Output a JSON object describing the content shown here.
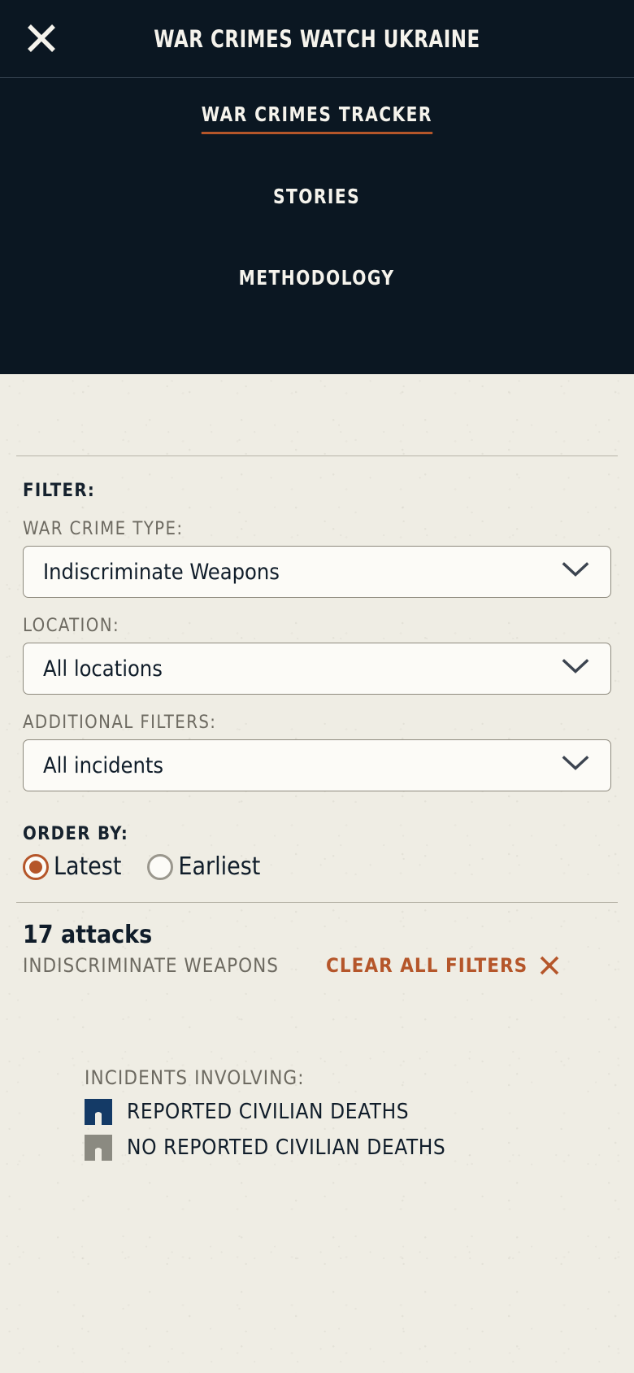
{
  "header": {
    "close_icon": "close-icon",
    "title": "WAR CRIMES WATCH UKRAINE",
    "background_color": "#0b1722",
    "accent_color": "#b5562a",
    "menu": [
      {
        "label": "WAR CRIMES TRACKER",
        "active": true
      },
      {
        "label": "STORIES",
        "active": false
      },
      {
        "label": "METHODOLOGY",
        "active": false
      }
    ]
  },
  "filters": {
    "heading": "FILTER:",
    "war_crime_type": {
      "label": "WAR CRIME TYPE:",
      "value": "Indiscriminate Weapons",
      "chevron_icon": "chevron-down-icon"
    },
    "location": {
      "label": "LOCATION:",
      "value": "All locations",
      "chevron_icon": "chevron-down-icon"
    },
    "additional": {
      "label": "ADDITIONAL FILTERS:",
      "value": "All incidents",
      "chevron_icon": "chevron-down-icon"
    },
    "order_by": {
      "label": "ORDER BY:",
      "options": [
        {
          "label": "Latest",
          "selected": true
        },
        {
          "label": "Earliest",
          "selected": false
        }
      ]
    }
  },
  "results": {
    "count_text": "17 attacks",
    "applied_filter_text": "INDISCRIMINATE WEAPONS",
    "clear_label": "CLEAR ALL FILTERS",
    "clear_icon": "close-icon"
  },
  "legend": {
    "title": "INCIDENTS INVOLVING:",
    "items": [
      {
        "label": "REPORTED CIVILIAN DEATHS",
        "color": "#143a66",
        "icon": "building-marker-icon"
      },
      {
        "label": "NO REPORTED CIVILIAN DEATHS",
        "color": "#8b8a81",
        "icon": "building-marker-icon"
      }
    ]
  }
}
